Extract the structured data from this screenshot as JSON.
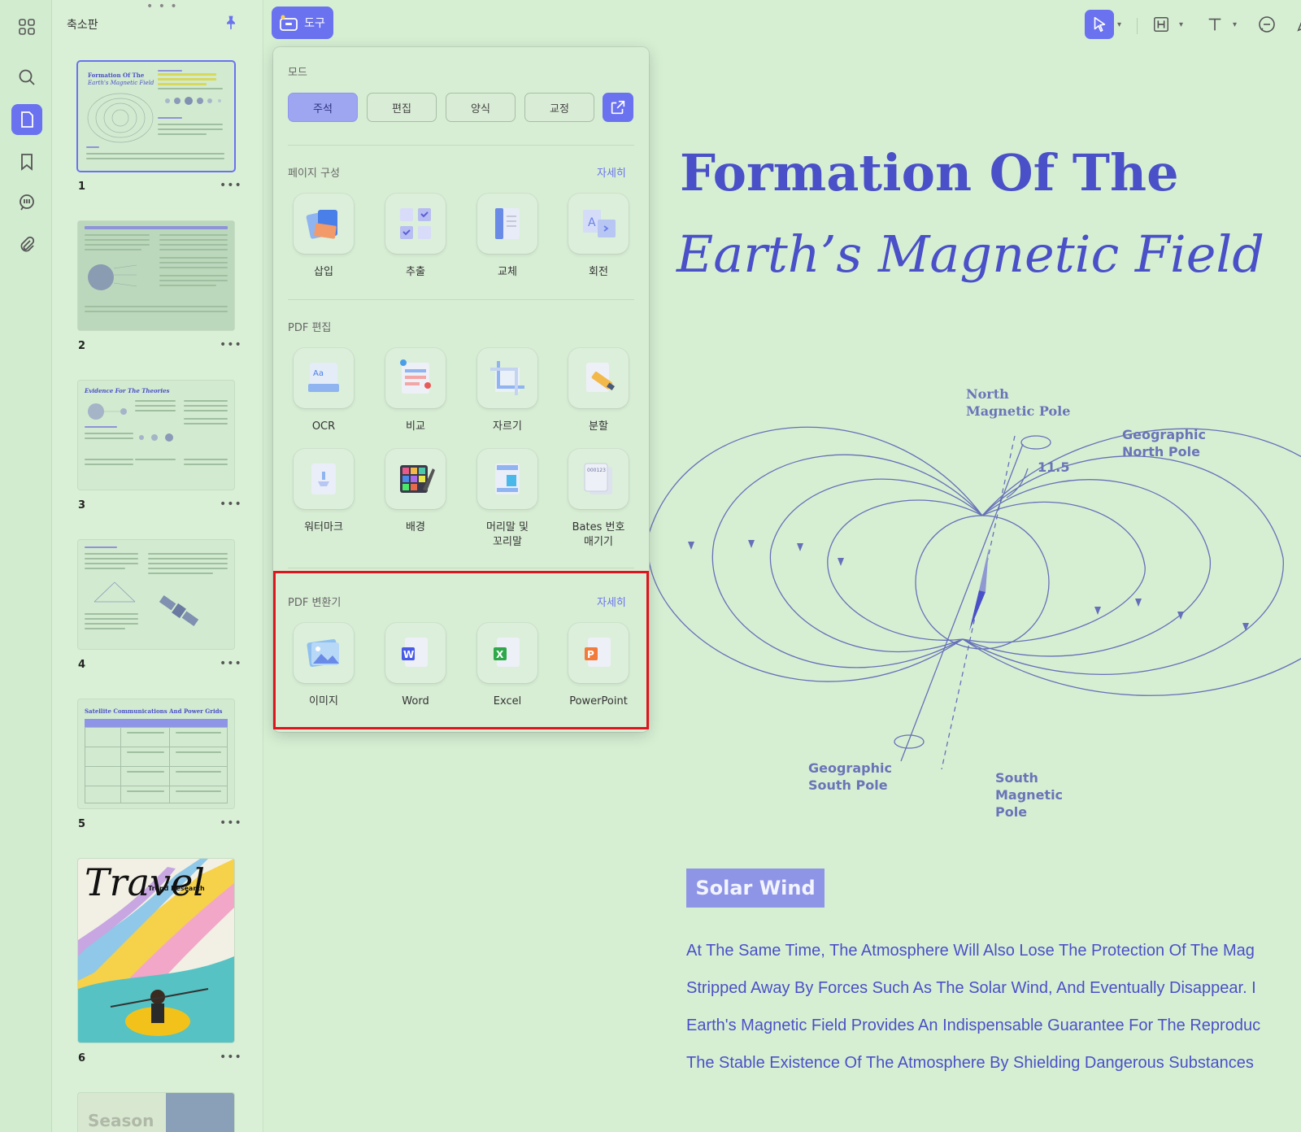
{
  "thumbnails": {
    "title": "축소판",
    "pages": [
      {
        "num": "1",
        "title1": "Formation Of The",
        "title2": "Earth's Magnetic Field"
      },
      {
        "num": "2"
      },
      {
        "num": "3",
        "title1": "Evidence For The Theories"
      },
      {
        "num": "4"
      },
      {
        "num": "5",
        "title1": "Satellite Communications And Power Grids"
      },
      {
        "num": "6",
        "title1": "Travel",
        "title2": "Trend Research"
      }
    ],
    "partial_page_text": "Season"
  },
  "tool_button": {
    "label": "도구"
  },
  "popup": {
    "mode_label": "모드",
    "modes": [
      "주석",
      "편집",
      "양식",
      "교정"
    ],
    "page_section": {
      "label": "페이지 구성",
      "more": "자세히",
      "items": [
        "삽입",
        "추출",
        "교체",
        "회전"
      ]
    },
    "edit_section": {
      "label": "PDF 편집",
      "items": [
        "OCR",
        "비교",
        "자르기",
        "분할",
        "워터마크",
        "배경",
        "머리말 및\n꼬리말",
        "Bates 번호\n매기기"
      ]
    },
    "convert_section": {
      "label": "PDF 변환기",
      "more": "자세히",
      "items": [
        "이미지",
        "Word",
        "Excel",
        "PowerPoint"
      ]
    }
  },
  "document": {
    "title_line1": "Formation Of The",
    "title_line2": "Earth’s Magnetic Field",
    "diagram_labels": {
      "north_magnetic": "North\nMagnetic Pole",
      "geo_north": "Geographic\nNorth Pole",
      "angle": "11.5",
      "geo_south": "Geographic\nSouth Pole",
      "south_magnetic": "South\nMagnetic\nPole"
    },
    "section_badge": "Solar Wind",
    "paragraph_lines": [
      "At The Same Time, The Atmosphere Will Also Lose The Protection Of The Mag",
      "Stripped Away By Forces Such As The Solar Wind, And Eventually Disappear. I",
      "Earth's Magnetic Field Provides An Indispensable Guarantee For The Reproduc",
      "The Stable Existence Of The Atmosphere By Shielding Dangerous Substances"
    ]
  },
  "colors": {
    "accent": "#6a72f0",
    "doc_text": "#4a50c8",
    "background": "#d6efd3",
    "highlight": "#e0141e"
  }
}
